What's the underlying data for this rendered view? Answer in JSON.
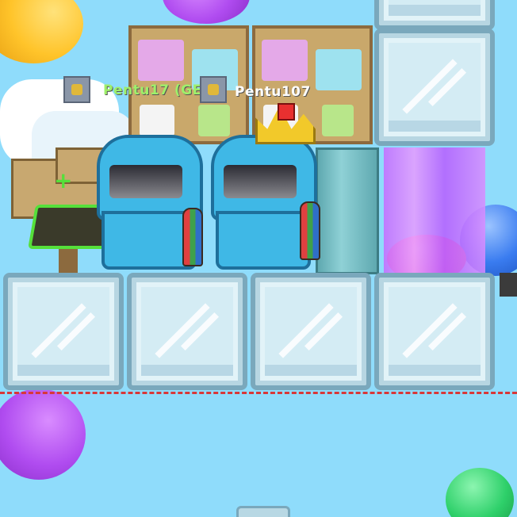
{
  "players": [
    {
      "name": "Pentu17 (GE",
      "name_color": "#9ef06a"
    },
    {
      "name": "Pentu107",
      "name_color": "#ffffff"
    }
  ],
  "colors": {
    "sky": "#8fdcfb",
    "glass": "#d4ecf4",
    "hood": "#3fb8e6",
    "curtain": "#c66bff",
    "balloon_yellow": "#ffc42a",
    "balloon_purple": "#b04cf0",
    "balloon_green": "#2ed06a",
    "balloon_blue": "#3a7cf0"
  },
  "icons": [
    "balloon-icon",
    "crown-icon",
    "rocket-icon",
    "glass-block-icon",
    "sign-icon"
  ]
}
